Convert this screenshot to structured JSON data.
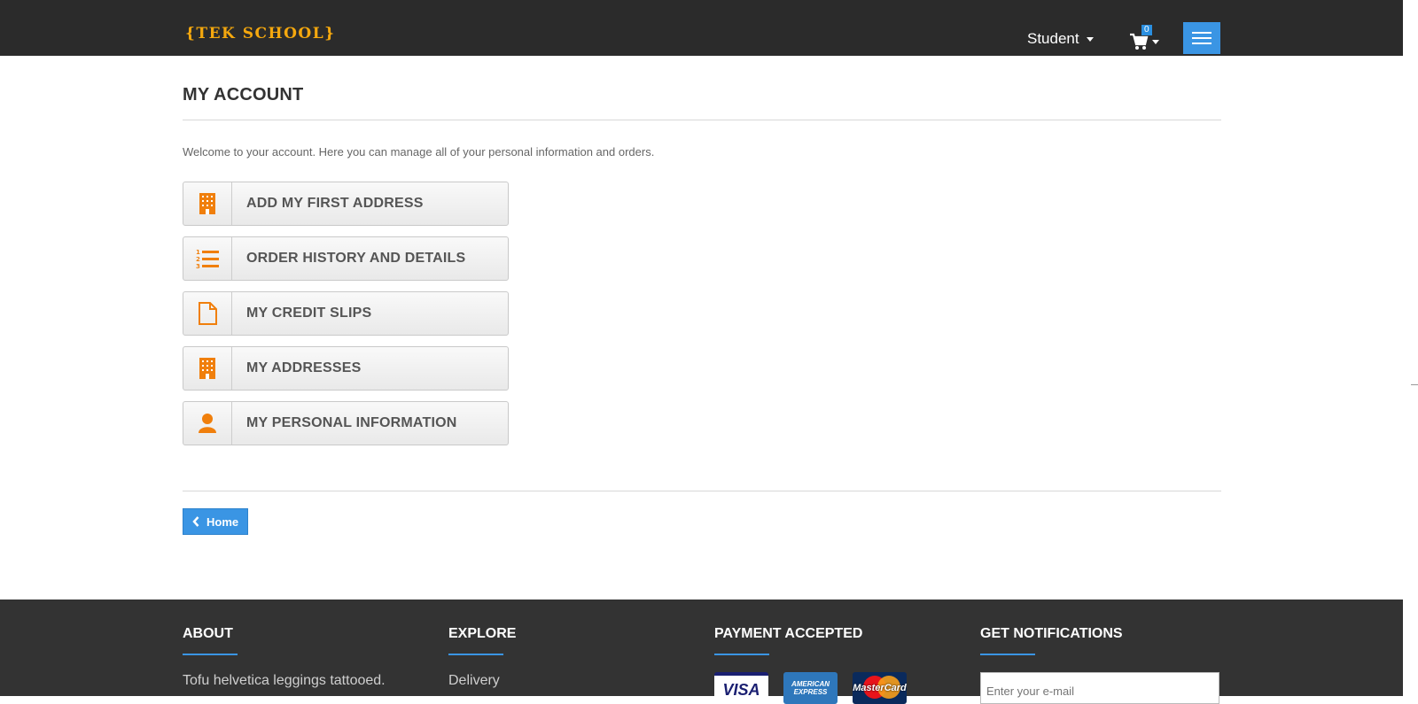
{
  "header": {
    "logo_text": "{TEK SCHOOL}",
    "user_label": "Student",
    "cart_count": "0"
  },
  "main": {
    "title": "MY ACCOUNT",
    "welcome": "Welcome to your account. Here you can manage all of your personal information and orders.",
    "buttons": [
      {
        "label": "ADD MY FIRST ADDRESS",
        "icon": "building-icon"
      },
      {
        "label": "ORDER HISTORY AND DETAILS",
        "icon": "ordered-list-icon"
      },
      {
        "label": "MY CREDIT SLIPS",
        "icon": "document-icon"
      },
      {
        "label": "MY ADDRESSES",
        "icon": "building-icon"
      },
      {
        "label": "MY PERSONAL INFORMATION",
        "icon": "user-icon"
      }
    ],
    "home_label": "Home"
  },
  "footer": {
    "about": {
      "heading": "ABOUT",
      "text": "Tofu helvetica leggings tattooed."
    },
    "explore": {
      "heading": "EXPLORE",
      "link": "Delivery"
    },
    "payment": {
      "heading": "PAYMENT ACCEPTED",
      "cards": [
        "VISA",
        "AMERICAN EXPRESS",
        "MasterCard"
      ]
    },
    "notifications": {
      "heading": "GET NOTIFICATIONS",
      "placeholder": "Enter your e-mail"
    }
  },
  "colors": {
    "header_bg": "#2b2b2b",
    "accent_blue": "#3a95e4",
    "icon_orange": "#f07f0c",
    "logo_gold": "#f5a80e",
    "footer_bg": "#333333"
  }
}
